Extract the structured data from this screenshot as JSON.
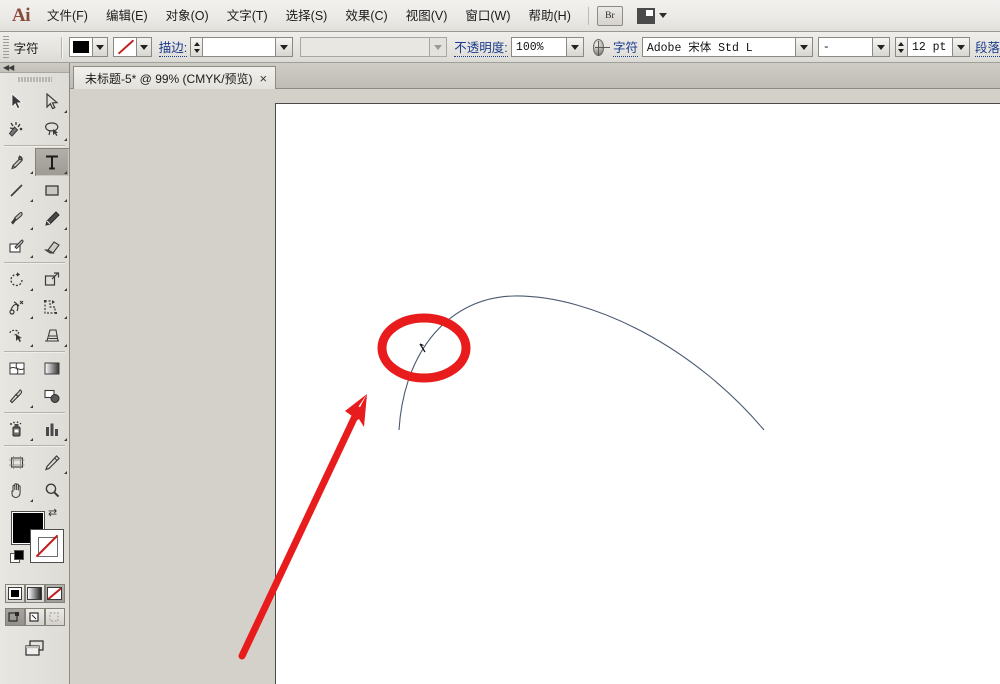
{
  "app": {
    "name": "Adobe Illustrator",
    "logo_text": "Ai"
  },
  "menubar": {
    "items": [
      {
        "label": "文件(F)",
        "name": "menu-file"
      },
      {
        "label": "编辑(E)",
        "name": "menu-edit"
      },
      {
        "label": "对象(O)",
        "name": "menu-object"
      },
      {
        "label": "文字(T)",
        "name": "menu-type"
      },
      {
        "label": "选择(S)",
        "name": "menu-select"
      },
      {
        "label": "效果(C)",
        "name": "menu-effect"
      },
      {
        "label": "视图(V)",
        "name": "menu-view"
      },
      {
        "label": "窗口(W)",
        "name": "menu-window"
      },
      {
        "label": "帮助(H)",
        "name": "menu-help"
      }
    ],
    "bridge_label": "Br",
    "workspace_switcher": "workspace-switcher"
  },
  "controlbar": {
    "char_label": "字符",
    "fill_color": "#000000",
    "stroke_color": "none",
    "stroke_label": "描边:",
    "stroke_weight_value": "",
    "stroke_profile_value": "",
    "opacity_label": "不透明度:",
    "opacity_value": "100%",
    "character_label": "字符",
    "font_family_value": "Adobe 宋体 Std L",
    "font_style_value": "-",
    "font_size_value": "12 pt",
    "paragraph_label": "段落"
  },
  "tabbar": {
    "document_title": "未标题-5* @ 99% (CMYK/预览)",
    "close_glyph": "×"
  },
  "tools": {
    "collapse_glyph": "◀◀",
    "items": [
      {
        "name": "selection-tool",
        "selected": false
      },
      {
        "name": "direct-selection-tool",
        "selected": false
      },
      {
        "name": "magic-wand-tool",
        "selected": false
      },
      {
        "name": "lasso-tool",
        "selected": false
      },
      {
        "name": "pen-tool",
        "selected": false
      },
      {
        "name": "type-tool",
        "selected": true
      },
      {
        "name": "line-segment-tool",
        "selected": false
      },
      {
        "name": "rectangle-tool",
        "selected": false
      },
      {
        "name": "paintbrush-tool",
        "selected": false
      },
      {
        "name": "pencil-tool",
        "selected": false
      },
      {
        "name": "blob-brush-tool",
        "selected": false
      },
      {
        "name": "eraser-tool",
        "selected": false
      },
      {
        "name": "rotate-tool",
        "selected": false
      },
      {
        "name": "scale-tool",
        "selected": false
      },
      {
        "name": "width-tool",
        "selected": false
      },
      {
        "name": "free-transform-tool",
        "selected": false
      },
      {
        "name": "shape-builder-tool",
        "selected": false
      },
      {
        "name": "perspective-grid-tool",
        "selected": false
      },
      {
        "name": "mesh-tool",
        "selected": false
      },
      {
        "name": "gradient-tool",
        "selected": false
      },
      {
        "name": "eyedropper-tool",
        "selected": false
      },
      {
        "name": "blend-tool",
        "selected": false
      },
      {
        "name": "symbol-sprayer-tool",
        "selected": false
      },
      {
        "name": "column-graph-tool",
        "selected": false
      },
      {
        "name": "artboard-tool",
        "selected": false
      },
      {
        "name": "slice-tool",
        "selected": false
      },
      {
        "name": "hand-tool",
        "selected": false
      },
      {
        "name": "zoom-tool",
        "selected": false
      }
    ],
    "fill_swatch": "#000000",
    "stroke_swatch": "none",
    "color_mode_buttons": [
      "color-mode-button",
      "gradient-mode-button",
      "none-mode-button"
    ],
    "draw_mode_buttons": [
      "draw-normal-button",
      "draw-behind-button",
      "draw-inside-button"
    ],
    "screen_mode_button": "screen-mode-button"
  },
  "canvas": {
    "artwork_name": "arc-path",
    "arc_stroke_color": "#4b5a70",
    "text_cursor_name": "text-insertion-cursor"
  },
  "annotations": {
    "highlight_ellipse": {
      "name": "red-highlight-ellipse",
      "color": "#e81c1c"
    },
    "pointer_arrow": {
      "name": "red-pointer-arrow",
      "color": "#e81c1c"
    }
  }
}
